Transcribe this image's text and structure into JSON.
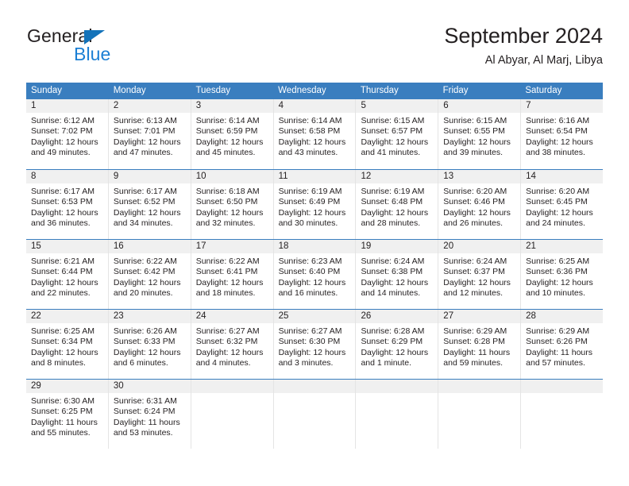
{
  "brand": {
    "name_top": "General",
    "name_bottom": "Blue",
    "triangle_color": "#1373ba",
    "blue_color": "#1b7fd4"
  },
  "header": {
    "title": "September 2024",
    "subtitle": "Al Abyar, Al Marj, Libya"
  },
  "theme": {
    "header_blue": "#3a7ebf",
    "daynum_band": "#f0f0f0",
    "cell_border": "#e4e4e4",
    "text": "#231f20"
  },
  "weekdays": [
    "Sunday",
    "Monday",
    "Tuesday",
    "Wednesday",
    "Thursday",
    "Friday",
    "Saturday"
  ],
  "weeks": [
    [
      {
        "day": "1",
        "sunrise": "Sunrise: 6:12 AM",
        "sunset": "Sunset: 7:02 PM",
        "daylight_1": "Daylight: 12 hours",
        "daylight_2": "and 49 minutes."
      },
      {
        "day": "2",
        "sunrise": "Sunrise: 6:13 AM",
        "sunset": "Sunset: 7:01 PM",
        "daylight_1": "Daylight: 12 hours",
        "daylight_2": "and 47 minutes."
      },
      {
        "day": "3",
        "sunrise": "Sunrise: 6:14 AM",
        "sunset": "Sunset: 6:59 PM",
        "daylight_1": "Daylight: 12 hours",
        "daylight_2": "and 45 minutes."
      },
      {
        "day": "4",
        "sunrise": "Sunrise: 6:14 AM",
        "sunset": "Sunset: 6:58 PM",
        "daylight_1": "Daylight: 12 hours",
        "daylight_2": "and 43 minutes."
      },
      {
        "day": "5",
        "sunrise": "Sunrise: 6:15 AM",
        "sunset": "Sunset: 6:57 PM",
        "daylight_1": "Daylight: 12 hours",
        "daylight_2": "and 41 minutes."
      },
      {
        "day": "6",
        "sunrise": "Sunrise: 6:15 AM",
        "sunset": "Sunset: 6:55 PM",
        "daylight_1": "Daylight: 12 hours",
        "daylight_2": "and 39 minutes."
      },
      {
        "day": "7",
        "sunrise": "Sunrise: 6:16 AM",
        "sunset": "Sunset: 6:54 PM",
        "daylight_1": "Daylight: 12 hours",
        "daylight_2": "and 38 minutes."
      }
    ],
    [
      {
        "day": "8",
        "sunrise": "Sunrise: 6:17 AM",
        "sunset": "Sunset: 6:53 PM",
        "daylight_1": "Daylight: 12 hours",
        "daylight_2": "and 36 minutes."
      },
      {
        "day": "9",
        "sunrise": "Sunrise: 6:17 AM",
        "sunset": "Sunset: 6:52 PM",
        "daylight_1": "Daylight: 12 hours",
        "daylight_2": "and 34 minutes."
      },
      {
        "day": "10",
        "sunrise": "Sunrise: 6:18 AM",
        "sunset": "Sunset: 6:50 PM",
        "daylight_1": "Daylight: 12 hours",
        "daylight_2": "and 32 minutes."
      },
      {
        "day": "11",
        "sunrise": "Sunrise: 6:19 AM",
        "sunset": "Sunset: 6:49 PM",
        "daylight_1": "Daylight: 12 hours",
        "daylight_2": "and 30 minutes."
      },
      {
        "day": "12",
        "sunrise": "Sunrise: 6:19 AM",
        "sunset": "Sunset: 6:48 PM",
        "daylight_1": "Daylight: 12 hours",
        "daylight_2": "and 28 minutes."
      },
      {
        "day": "13",
        "sunrise": "Sunrise: 6:20 AM",
        "sunset": "Sunset: 6:46 PM",
        "daylight_1": "Daylight: 12 hours",
        "daylight_2": "and 26 minutes."
      },
      {
        "day": "14",
        "sunrise": "Sunrise: 6:20 AM",
        "sunset": "Sunset: 6:45 PM",
        "daylight_1": "Daylight: 12 hours",
        "daylight_2": "and 24 minutes."
      }
    ],
    [
      {
        "day": "15",
        "sunrise": "Sunrise: 6:21 AM",
        "sunset": "Sunset: 6:44 PM",
        "daylight_1": "Daylight: 12 hours",
        "daylight_2": "and 22 minutes."
      },
      {
        "day": "16",
        "sunrise": "Sunrise: 6:22 AM",
        "sunset": "Sunset: 6:42 PM",
        "daylight_1": "Daylight: 12 hours",
        "daylight_2": "and 20 minutes."
      },
      {
        "day": "17",
        "sunrise": "Sunrise: 6:22 AM",
        "sunset": "Sunset: 6:41 PM",
        "daylight_1": "Daylight: 12 hours",
        "daylight_2": "and 18 minutes."
      },
      {
        "day": "18",
        "sunrise": "Sunrise: 6:23 AM",
        "sunset": "Sunset: 6:40 PM",
        "daylight_1": "Daylight: 12 hours",
        "daylight_2": "and 16 minutes."
      },
      {
        "day": "19",
        "sunrise": "Sunrise: 6:24 AM",
        "sunset": "Sunset: 6:38 PM",
        "daylight_1": "Daylight: 12 hours",
        "daylight_2": "and 14 minutes."
      },
      {
        "day": "20",
        "sunrise": "Sunrise: 6:24 AM",
        "sunset": "Sunset: 6:37 PM",
        "daylight_1": "Daylight: 12 hours",
        "daylight_2": "and 12 minutes."
      },
      {
        "day": "21",
        "sunrise": "Sunrise: 6:25 AM",
        "sunset": "Sunset: 6:36 PM",
        "daylight_1": "Daylight: 12 hours",
        "daylight_2": "and 10 minutes."
      }
    ],
    [
      {
        "day": "22",
        "sunrise": "Sunrise: 6:25 AM",
        "sunset": "Sunset: 6:34 PM",
        "daylight_1": "Daylight: 12 hours",
        "daylight_2": "and 8 minutes."
      },
      {
        "day": "23",
        "sunrise": "Sunrise: 6:26 AM",
        "sunset": "Sunset: 6:33 PM",
        "daylight_1": "Daylight: 12 hours",
        "daylight_2": "and 6 minutes."
      },
      {
        "day": "24",
        "sunrise": "Sunrise: 6:27 AM",
        "sunset": "Sunset: 6:32 PM",
        "daylight_1": "Daylight: 12 hours",
        "daylight_2": "and 4 minutes."
      },
      {
        "day": "25",
        "sunrise": "Sunrise: 6:27 AM",
        "sunset": "Sunset: 6:30 PM",
        "daylight_1": "Daylight: 12 hours",
        "daylight_2": "and 3 minutes."
      },
      {
        "day": "26",
        "sunrise": "Sunrise: 6:28 AM",
        "sunset": "Sunset: 6:29 PM",
        "daylight_1": "Daylight: 12 hours",
        "daylight_2": "and 1 minute."
      },
      {
        "day": "27",
        "sunrise": "Sunrise: 6:29 AM",
        "sunset": "Sunset: 6:28 PM",
        "daylight_1": "Daylight: 11 hours",
        "daylight_2": "and 59 minutes."
      },
      {
        "day": "28",
        "sunrise": "Sunrise: 6:29 AM",
        "sunset": "Sunset: 6:26 PM",
        "daylight_1": "Daylight: 11 hours",
        "daylight_2": "and 57 minutes."
      }
    ],
    [
      {
        "day": "29",
        "sunrise": "Sunrise: 6:30 AM",
        "sunset": "Sunset: 6:25 PM",
        "daylight_1": "Daylight: 11 hours",
        "daylight_2": "and 55 minutes."
      },
      {
        "day": "30",
        "sunrise": "Sunrise: 6:31 AM",
        "sunset": "Sunset: 6:24 PM",
        "daylight_1": "Daylight: 11 hours",
        "daylight_2": "and 53 minutes."
      },
      {
        "day": "",
        "sunrise": "",
        "sunset": "",
        "daylight_1": "",
        "daylight_2": ""
      },
      {
        "day": "",
        "sunrise": "",
        "sunset": "",
        "daylight_1": "",
        "daylight_2": ""
      },
      {
        "day": "",
        "sunrise": "",
        "sunset": "",
        "daylight_1": "",
        "daylight_2": ""
      },
      {
        "day": "",
        "sunrise": "",
        "sunset": "",
        "daylight_1": "",
        "daylight_2": ""
      },
      {
        "day": "",
        "sunrise": "",
        "sunset": "",
        "daylight_1": "",
        "daylight_2": ""
      }
    ]
  ]
}
